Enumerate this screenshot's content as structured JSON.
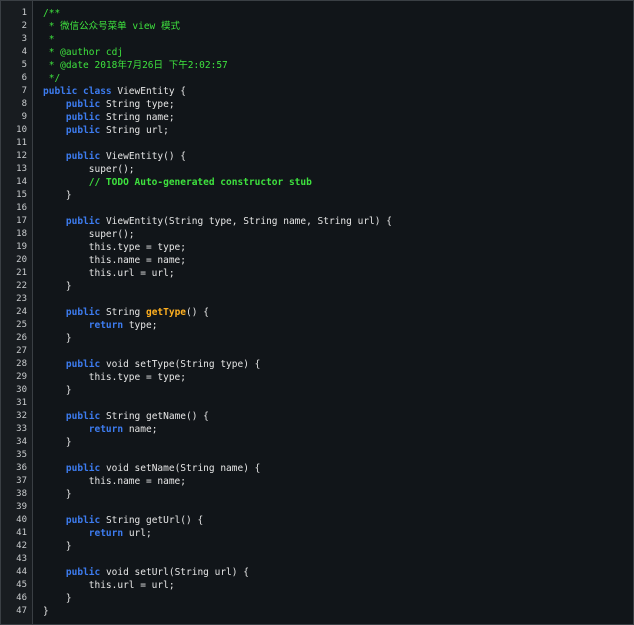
{
  "editor": {
    "lines": [
      {
        "num": "1",
        "tokens": [
          {
            "t": "/**",
            "c": "comment"
          }
        ]
      },
      {
        "num": "2",
        "tokens": [
          {
            "t": " * 微信公众号菜单 view 模式",
            "c": "comment"
          }
        ]
      },
      {
        "num": "3",
        "tokens": [
          {
            "t": " *",
            "c": "comment"
          }
        ]
      },
      {
        "num": "4",
        "tokens": [
          {
            "t": " * @author cdj",
            "c": "comment"
          }
        ]
      },
      {
        "num": "5",
        "tokens": [
          {
            "t": " * @date 2018年7月26日 下午2:02:57",
            "c": "comment"
          }
        ]
      },
      {
        "num": "6",
        "tokens": [
          {
            "t": " */",
            "c": "comment"
          }
        ]
      },
      {
        "num": "7",
        "tokens": [
          {
            "t": "public class",
            "c": "keyword"
          },
          {
            "t": " ViewEntity {",
            "c": "plain"
          }
        ]
      },
      {
        "num": "8",
        "tokens": [
          {
            "t": "    ",
            "c": "plain"
          },
          {
            "t": "public",
            "c": "keyword"
          },
          {
            "t": " String type;",
            "c": "plain"
          }
        ]
      },
      {
        "num": "9",
        "tokens": [
          {
            "t": "    ",
            "c": "plain"
          },
          {
            "t": "public",
            "c": "keyword"
          },
          {
            "t": " String name;",
            "c": "plain"
          }
        ]
      },
      {
        "num": "10",
        "tokens": [
          {
            "t": "    ",
            "c": "plain"
          },
          {
            "t": "public",
            "c": "keyword"
          },
          {
            "t": " String url;",
            "c": "plain"
          }
        ]
      },
      {
        "num": "11",
        "tokens": []
      },
      {
        "num": "12",
        "tokens": [
          {
            "t": "    ",
            "c": "plain"
          },
          {
            "t": "public",
            "c": "keyword"
          },
          {
            "t": " ViewEntity() {",
            "c": "plain"
          }
        ]
      },
      {
        "num": "13",
        "tokens": [
          {
            "t": "        super();",
            "c": "plain"
          }
        ]
      },
      {
        "num": "14",
        "tokens": [
          {
            "t": "        // TODO Auto-generated constructor stub",
            "c": "todo"
          }
        ]
      },
      {
        "num": "15",
        "tokens": [
          {
            "t": "    }",
            "c": "plain"
          }
        ]
      },
      {
        "num": "16",
        "tokens": []
      },
      {
        "num": "17",
        "tokens": [
          {
            "t": "    ",
            "c": "plain"
          },
          {
            "t": "public",
            "c": "keyword"
          },
          {
            "t": " ViewEntity(String type, String name, String url) {",
            "c": "plain"
          }
        ]
      },
      {
        "num": "18",
        "tokens": [
          {
            "t": "        super();",
            "c": "plain"
          }
        ]
      },
      {
        "num": "19",
        "tokens": [
          {
            "t": "        this.type = type;",
            "c": "plain"
          }
        ]
      },
      {
        "num": "20",
        "tokens": [
          {
            "t": "        this.name = name;",
            "c": "plain"
          }
        ]
      },
      {
        "num": "21",
        "tokens": [
          {
            "t": "        this.url = url;",
            "c": "plain"
          }
        ]
      },
      {
        "num": "22",
        "tokens": [
          {
            "t": "    }",
            "c": "plain"
          }
        ]
      },
      {
        "num": "23",
        "tokens": []
      },
      {
        "num": "24",
        "tokens": [
          {
            "t": "    ",
            "c": "plain"
          },
          {
            "t": "public",
            "c": "keyword"
          },
          {
            "t": " String ",
            "c": "plain"
          },
          {
            "t": "getType",
            "c": "method"
          },
          {
            "t": "() {",
            "c": "plain"
          }
        ]
      },
      {
        "num": "25",
        "tokens": [
          {
            "t": "        ",
            "c": "plain"
          },
          {
            "t": "return",
            "c": "keyword"
          },
          {
            "t": " type;",
            "c": "plain"
          }
        ]
      },
      {
        "num": "26",
        "tokens": [
          {
            "t": "    }",
            "c": "plain"
          }
        ]
      },
      {
        "num": "27",
        "tokens": []
      },
      {
        "num": "28",
        "tokens": [
          {
            "t": "    ",
            "c": "plain"
          },
          {
            "t": "public",
            "c": "keyword"
          },
          {
            "t": " void setType(String type) {",
            "c": "plain"
          }
        ]
      },
      {
        "num": "29",
        "tokens": [
          {
            "t": "        this.type = type;",
            "c": "plain"
          }
        ]
      },
      {
        "num": "30",
        "tokens": [
          {
            "t": "    }",
            "c": "plain"
          }
        ]
      },
      {
        "num": "31",
        "tokens": []
      },
      {
        "num": "32",
        "tokens": [
          {
            "t": "    ",
            "c": "plain"
          },
          {
            "t": "public",
            "c": "keyword"
          },
          {
            "t": " String getName() {",
            "c": "plain"
          }
        ]
      },
      {
        "num": "33",
        "tokens": [
          {
            "t": "        ",
            "c": "plain"
          },
          {
            "t": "return",
            "c": "keyword"
          },
          {
            "t": " name;",
            "c": "plain"
          }
        ]
      },
      {
        "num": "34",
        "tokens": [
          {
            "t": "    }",
            "c": "plain"
          }
        ]
      },
      {
        "num": "35",
        "tokens": []
      },
      {
        "num": "36",
        "tokens": [
          {
            "t": "    ",
            "c": "plain"
          },
          {
            "t": "public",
            "c": "keyword"
          },
          {
            "t": " void setName(String name) {",
            "c": "plain"
          }
        ]
      },
      {
        "num": "37",
        "tokens": [
          {
            "t": "        this.name = name;",
            "c": "plain"
          }
        ]
      },
      {
        "num": "38",
        "tokens": [
          {
            "t": "    }",
            "c": "plain"
          }
        ]
      },
      {
        "num": "39",
        "tokens": []
      },
      {
        "num": "40",
        "tokens": [
          {
            "t": "    ",
            "c": "plain"
          },
          {
            "t": "public",
            "c": "keyword"
          },
          {
            "t": " String getUrl() {",
            "c": "plain"
          }
        ]
      },
      {
        "num": "41",
        "tokens": [
          {
            "t": "        ",
            "c": "plain"
          },
          {
            "t": "return",
            "c": "keyword"
          },
          {
            "t": " url;",
            "c": "plain"
          }
        ]
      },
      {
        "num": "42",
        "tokens": [
          {
            "t": "    }",
            "c": "plain"
          }
        ]
      },
      {
        "num": "43",
        "tokens": []
      },
      {
        "num": "44",
        "tokens": [
          {
            "t": "    ",
            "c": "plain"
          },
          {
            "t": "public",
            "c": "keyword"
          },
          {
            "t": " void setUrl(String url) {",
            "c": "plain"
          }
        ]
      },
      {
        "num": "45",
        "tokens": [
          {
            "t": "        this.url = url;",
            "c": "plain"
          }
        ]
      },
      {
        "num": "46",
        "tokens": [
          {
            "t": "    }",
            "c": "plain"
          }
        ]
      },
      {
        "num": "47",
        "tokens": [
          {
            "t": "}",
            "c": "plain"
          }
        ]
      }
    ]
  },
  "colors": {
    "background": "#111519",
    "gutter": "#181c20",
    "comment": "#3ee23e",
    "keyword": "#3d7cf0",
    "method": "#ffb020",
    "plain": "#e6e6e6"
  }
}
